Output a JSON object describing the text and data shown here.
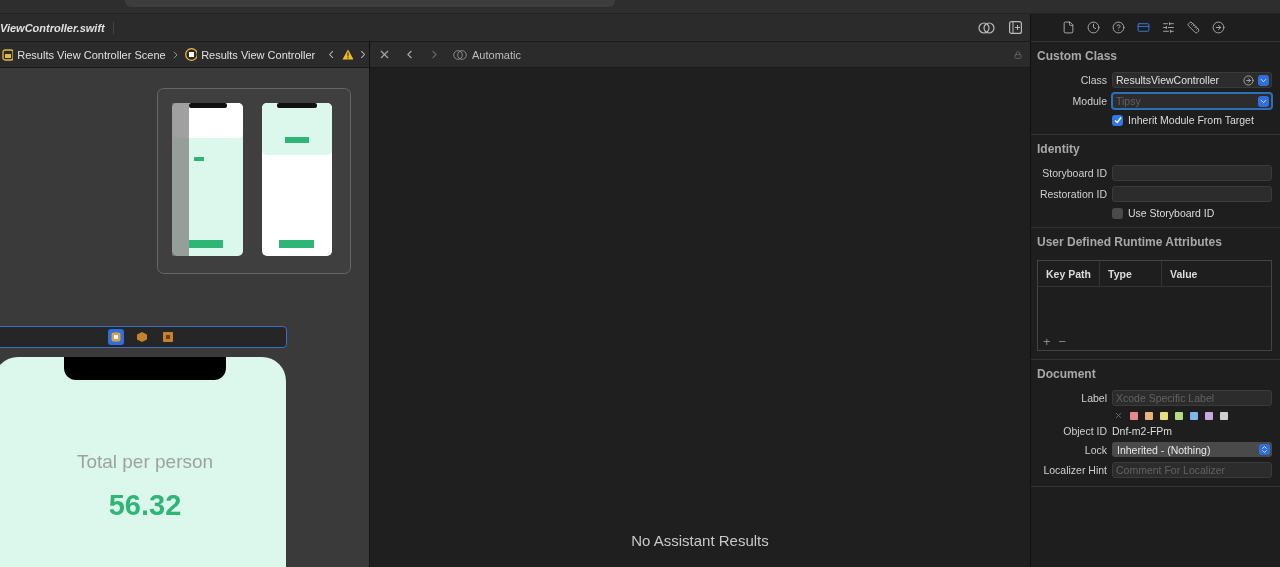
{
  "editor_tab": {
    "title": "ViewController.swift"
  },
  "jump_bar": {
    "items": [
      {
        "label": "Results View Controller Scene",
        "kind": "scene"
      },
      {
        "label": "Results View Controller",
        "kind": "controller"
      }
    ]
  },
  "assistant": {
    "mode": "Automatic",
    "empty_message": "No Assistant Results"
  },
  "canvas": {
    "scene": {
      "label": "Total per person",
      "value": "56.32",
      "dock_icons": [
        {
          "kind": "controller",
          "selected": true
        },
        {
          "kind": "responder",
          "selected": false
        },
        {
          "kind": "exit",
          "selected": false
        }
      ]
    }
  },
  "inspector": {
    "tabs": [
      {
        "kind": "file",
        "selected": false
      },
      {
        "kind": "history",
        "selected": false
      },
      {
        "kind": "help",
        "selected": false
      },
      {
        "kind": "identity",
        "selected": true
      },
      {
        "kind": "attributes",
        "selected": false
      },
      {
        "kind": "size",
        "selected": false
      },
      {
        "kind": "connections",
        "selected": false
      }
    ],
    "custom_class": {
      "title": "Custom Class",
      "class_label": "Class",
      "class_value": "ResultsViewController",
      "module_label": "Module",
      "module_placeholder": "Tipsy",
      "inherit_label": "Inherit Module From Target",
      "inherit_checked": true
    },
    "identity": {
      "title": "Identity",
      "fields": [
        {
          "label": "Storyboard ID"
        },
        {
          "label": "Restoration ID"
        }
      ],
      "use_storyboard_label": "Use Storyboard ID",
      "use_storyboard_checked": false
    },
    "runtime": {
      "title": "User Defined Runtime Attributes",
      "columns": [
        "Key Path",
        "Type",
        "Value"
      ],
      "add": "+",
      "remove": "−"
    },
    "document": {
      "title": "Document",
      "label_label": "Label",
      "label_placeholder": "Xcode Specific Label",
      "colors": [
        {
          "color": "#e98a8a"
        },
        {
          "color": "#e9b67a"
        },
        {
          "color": "#e6df7c"
        },
        {
          "color": "#b9dc7e"
        },
        {
          "color": "#7fb7ea"
        },
        {
          "color": "#c8a9e6"
        },
        {
          "color": "#cfcfcf"
        }
      ],
      "object_id_label": "Object ID",
      "object_id": "Dnf-m2-FPm",
      "lock_label": "Lock",
      "lock_value": "Inherited - (Nothing)",
      "hint_label": "Localizer Hint",
      "hint_placeholder": "Comment For Localizer"
    }
  }
}
